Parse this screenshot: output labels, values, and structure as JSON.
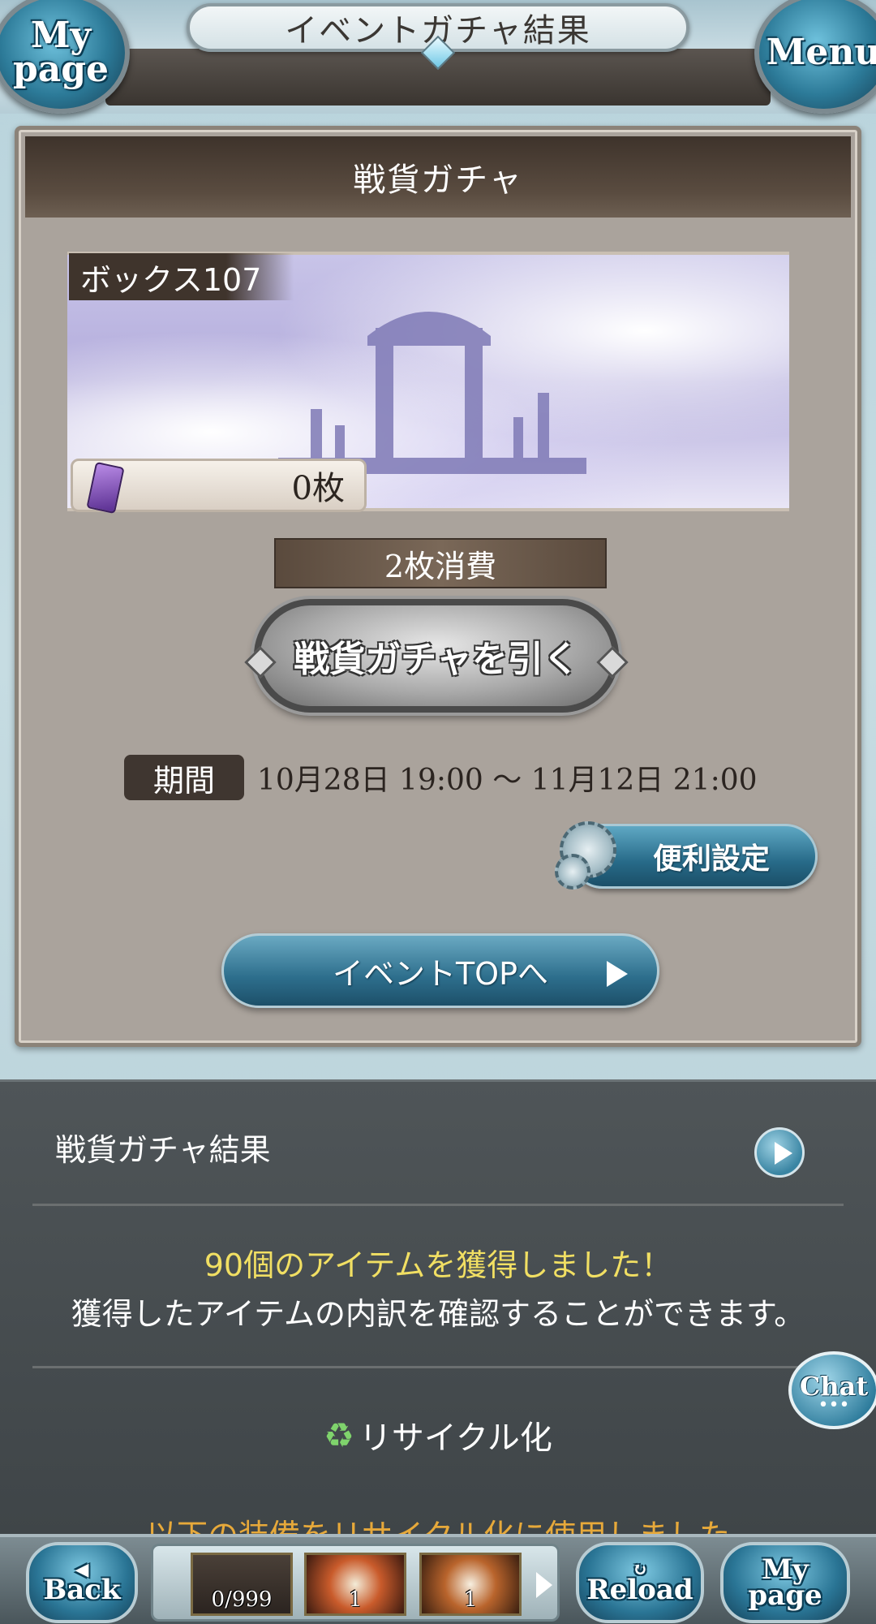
{
  "header": {
    "title": "イベントガチャ結果",
    "mypage_label": "My\npage",
    "menu_label": "Menu"
  },
  "panel": {
    "title": "戦貨ガチャ",
    "box_label": "ボックス107",
    "ticket_count": "0枚",
    "cost": "2枚消費",
    "draw_button": "戦貨ガチャを引く",
    "period_tag": "期間",
    "period": "10月28日 19:00 〜 11月12日 21:00",
    "settings_button": "便利設定",
    "event_top_button": "イベントTOPへ"
  },
  "results": {
    "title": "戦貨ガチャ結果",
    "gain_message": "90個のアイテムを獲得しました！",
    "gain_sub": "獲得したアイテムの内訳を確認することができます。",
    "recycle_label": "リサイクル化",
    "recycle_note": "以下の装備をリサイクル化に使用しました"
  },
  "chat": {
    "label": "Chat",
    "dots": "•••"
  },
  "bottom_bar": {
    "back_label": "Back",
    "reload_label": "Reload",
    "mypage_label": "My\npage",
    "items": [
      {
        "count": "0/999"
      },
      {
        "count": "1"
      },
      {
        "count": "1"
      }
    ]
  },
  "colors": {
    "accent_blue": "#2d6e8c",
    "panel_bg": "#aaa39c",
    "dark_section": "#4f5558",
    "gain_yellow": "#f1df63",
    "note_orange": "#e7a93a"
  },
  "icons": [
    "ticket-icon",
    "gear-icon",
    "play-icon",
    "recycle-icon",
    "arrow-right-icon",
    "back-arrow-icon",
    "reload-icon"
  ]
}
